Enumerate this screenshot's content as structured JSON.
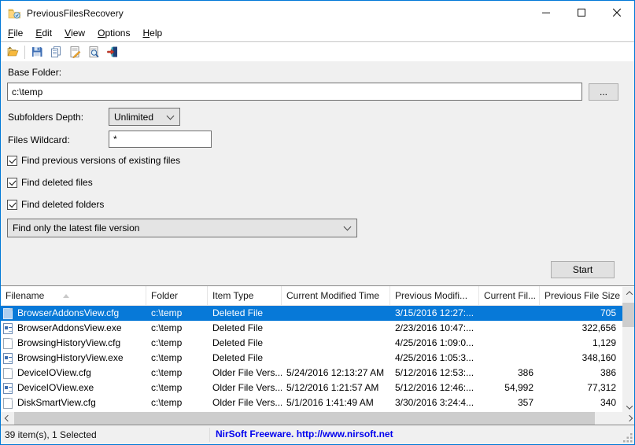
{
  "window": {
    "title": "PreviousFilesRecovery"
  },
  "menu": {
    "items": [
      "File",
      "Edit",
      "View",
      "Options",
      "Help"
    ]
  },
  "toolbar": {
    "icons": [
      "open-folder",
      "save",
      "copy",
      "properties",
      "find",
      "exit"
    ]
  },
  "form": {
    "base_folder_label": "Base Folder:",
    "base_folder_value": "c:\\temp",
    "browse_button": "...",
    "subfolders_label": "Subfolders Depth:",
    "subfolders_value": "Unlimited",
    "wildcard_label": "Files Wildcard:",
    "wildcard_value": "*",
    "checkboxes": [
      {
        "label": "Find previous versions of existing files",
        "checked": true
      },
      {
        "label": "Find deleted files",
        "checked": true
      },
      {
        "label": "Find deleted folders",
        "checked": true
      }
    ],
    "version_mode_value": "Find only the latest file version",
    "start_button": "Start"
  },
  "table": {
    "columns": [
      "Filename",
      "Folder",
      "Item Type",
      "Current Modified Time",
      "Previous Modifi...",
      "Current Fil...",
      "Previous File Size"
    ],
    "rows": [
      {
        "icon": "document",
        "selected": true,
        "filename": "BrowserAddonsView.cfg",
        "folder": "c:\\temp",
        "item_type": "Deleted File",
        "current_modified": "",
        "previous_modified": "3/15/2016 12:27:...",
        "current_size": "",
        "previous_size": "705"
      },
      {
        "icon": "application",
        "selected": false,
        "filename": "BrowserAddonsView.exe",
        "folder": "c:\\temp",
        "item_type": "Deleted File",
        "current_modified": "",
        "previous_modified": "2/23/2016 10:47:...",
        "current_size": "",
        "previous_size": "322,656"
      },
      {
        "icon": "document",
        "selected": false,
        "filename": "BrowsingHistoryView.cfg",
        "folder": "c:\\temp",
        "item_type": "Deleted File",
        "current_modified": "",
        "previous_modified": "4/25/2016 1:09:0...",
        "current_size": "",
        "previous_size": "1,129"
      },
      {
        "icon": "application",
        "selected": false,
        "filename": "BrowsingHistoryView.exe",
        "folder": "c:\\temp",
        "item_type": "Deleted File",
        "current_modified": "",
        "previous_modified": "4/25/2016 1:05:3...",
        "current_size": "",
        "previous_size": "348,160"
      },
      {
        "icon": "document",
        "selected": false,
        "filename": "DeviceIOView.cfg",
        "folder": "c:\\temp",
        "item_type": "Older File Vers...",
        "current_modified": "5/24/2016 12:13:27 AM",
        "previous_modified": "5/12/2016 12:53:...",
        "current_size": "386",
        "previous_size": "386"
      },
      {
        "icon": "application",
        "selected": false,
        "filename": "DeviceIOView.exe",
        "folder": "c:\\temp",
        "item_type": "Older File Vers...",
        "current_modified": "5/12/2016 1:21:57 AM",
        "previous_modified": "5/12/2016 12:46:...",
        "current_size": "54,992",
        "previous_size": "77,312"
      },
      {
        "icon": "document",
        "selected": false,
        "filename": "DiskSmartView.cfg",
        "folder": "c:\\temp",
        "item_type": "Older File Vers...",
        "current_modified": "5/1/2016 1:41:49 AM",
        "previous_modified": "3/30/2016 3:24:4...",
        "current_size": "357",
        "previous_size": "340"
      }
    ]
  },
  "statusbar": {
    "items_text": "39 item(s), 1 Selected",
    "nirsoft_text": "NirSoft Freeware.  http://www.nirsoft.net"
  },
  "colors": {
    "accent": "#0078d7",
    "selection": "#0779d8",
    "link_blue": "#0000ee"
  }
}
